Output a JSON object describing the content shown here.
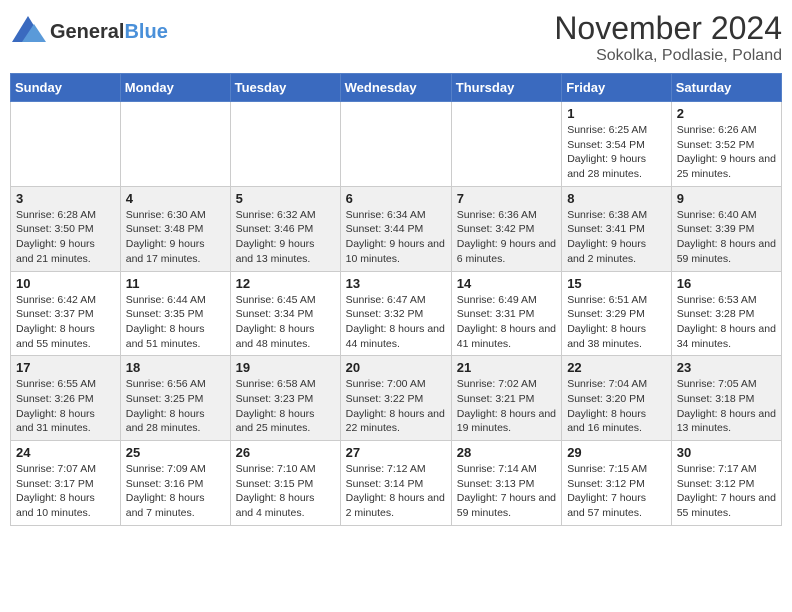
{
  "header": {
    "logo_general": "General",
    "logo_blue": "Blue",
    "month": "November 2024",
    "location": "Sokolka, Podlasie, Poland"
  },
  "weekdays": [
    "Sunday",
    "Monday",
    "Tuesday",
    "Wednesday",
    "Thursday",
    "Friday",
    "Saturday"
  ],
  "weeks": [
    [
      {
        "day": "",
        "info": ""
      },
      {
        "day": "",
        "info": ""
      },
      {
        "day": "",
        "info": ""
      },
      {
        "day": "",
        "info": ""
      },
      {
        "day": "",
        "info": ""
      },
      {
        "day": "1",
        "info": "Sunrise: 6:25 AM\nSunset: 3:54 PM\nDaylight: 9 hours and 28 minutes."
      },
      {
        "day": "2",
        "info": "Sunrise: 6:26 AM\nSunset: 3:52 PM\nDaylight: 9 hours and 25 minutes."
      }
    ],
    [
      {
        "day": "3",
        "info": "Sunrise: 6:28 AM\nSunset: 3:50 PM\nDaylight: 9 hours and 21 minutes."
      },
      {
        "day": "4",
        "info": "Sunrise: 6:30 AM\nSunset: 3:48 PM\nDaylight: 9 hours and 17 minutes."
      },
      {
        "day": "5",
        "info": "Sunrise: 6:32 AM\nSunset: 3:46 PM\nDaylight: 9 hours and 13 minutes."
      },
      {
        "day": "6",
        "info": "Sunrise: 6:34 AM\nSunset: 3:44 PM\nDaylight: 9 hours and 10 minutes."
      },
      {
        "day": "7",
        "info": "Sunrise: 6:36 AM\nSunset: 3:42 PM\nDaylight: 9 hours and 6 minutes."
      },
      {
        "day": "8",
        "info": "Sunrise: 6:38 AM\nSunset: 3:41 PM\nDaylight: 9 hours and 2 minutes."
      },
      {
        "day": "9",
        "info": "Sunrise: 6:40 AM\nSunset: 3:39 PM\nDaylight: 8 hours and 59 minutes."
      }
    ],
    [
      {
        "day": "10",
        "info": "Sunrise: 6:42 AM\nSunset: 3:37 PM\nDaylight: 8 hours and 55 minutes."
      },
      {
        "day": "11",
        "info": "Sunrise: 6:44 AM\nSunset: 3:35 PM\nDaylight: 8 hours and 51 minutes."
      },
      {
        "day": "12",
        "info": "Sunrise: 6:45 AM\nSunset: 3:34 PM\nDaylight: 8 hours and 48 minutes."
      },
      {
        "day": "13",
        "info": "Sunrise: 6:47 AM\nSunset: 3:32 PM\nDaylight: 8 hours and 44 minutes."
      },
      {
        "day": "14",
        "info": "Sunrise: 6:49 AM\nSunset: 3:31 PM\nDaylight: 8 hours and 41 minutes."
      },
      {
        "day": "15",
        "info": "Sunrise: 6:51 AM\nSunset: 3:29 PM\nDaylight: 8 hours and 38 minutes."
      },
      {
        "day": "16",
        "info": "Sunrise: 6:53 AM\nSunset: 3:28 PM\nDaylight: 8 hours and 34 minutes."
      }
    ],
    [
      {
        "day": "17",
        "info": "Sunrise: 6:55 AM\nSunset: 3:26 PM\nDaylight: 8 hours and 31 minutes."
      },
      {
        "day": "18",
        "info": "Sunrise: 6:56 AM\nSunset: 3:25 PM\nDaylight: 8 hours and 28 minutes."
      },
      {
        "day": "19",
        "info": "Sunrise: 6:58 AM\nSunset: 3:23 PM\nDaylight: 8 hours and 25 minutes."
      },
      {
        "day": "20",
        "info": "Sunrise: 7:00 AM\nSunset: 3:22 PM\nDaylight: 8 hours and 22 minutes."
      },
      {
        "day": "21",
        "info": "Sunrise: 7:02 AM\nSunset: 3:21 PM\nDaylight: 8 hours and 19 minutes."
      },
      {
        "day": "22",
        "info": "Sunrise: 7:04 AM\nSunset: 3:20 PM\nDaylight: 8 hours and 16 minutes."
      },
      {
        "day": "23",
        "info": "Sunrise: 7:05 AM\nSunset: 3:18 PM\nDaylight: 8 hours and 13 minutes."
      }
    ],
    [
      {
        "day": "24",
        "info": "Sunrise: 7:07 AM\nSunset: 3:17 PM\nDaylight: 8 hours and 10 minutes."
      },
      {
        "day": "25",
        "info": "Sunrise: 7:09 AM\nSunset: 3:16 PM\nDaylight: 8 hours and 7 minutes."
      },
      {
        "day": "26",
        "info": "Sunrise: 7:10 AM\nSunset: 3:15 PM\nDaylight: 8 hours and 4 minutes."
      },
      {
        "day": "27",
        "info": "Sunrise: 7:12 AM\nSunset: 3:14 PM\nDaylight: 8 hours and 2 minutes."
      },
      {
        "day": "28",
        "info": "Sunrise: 7:14 AM\nSunset: 3:13 PM\nDaylight: 7 hours and 59 minutes."
      },
      {
        "day": "29",
        "info": "Sunrise: 7:15 AM\nSunset: 3:12 PM\nDaylight: 7 hours and 57 minutes."
      },
      {
        "day": "30",
        "info": "Sunrise: 7:17 AM\nSunset: 3:12 PM\nDaylight: 7 hours and 55 minutes."
      }
    ]
  ]
}
